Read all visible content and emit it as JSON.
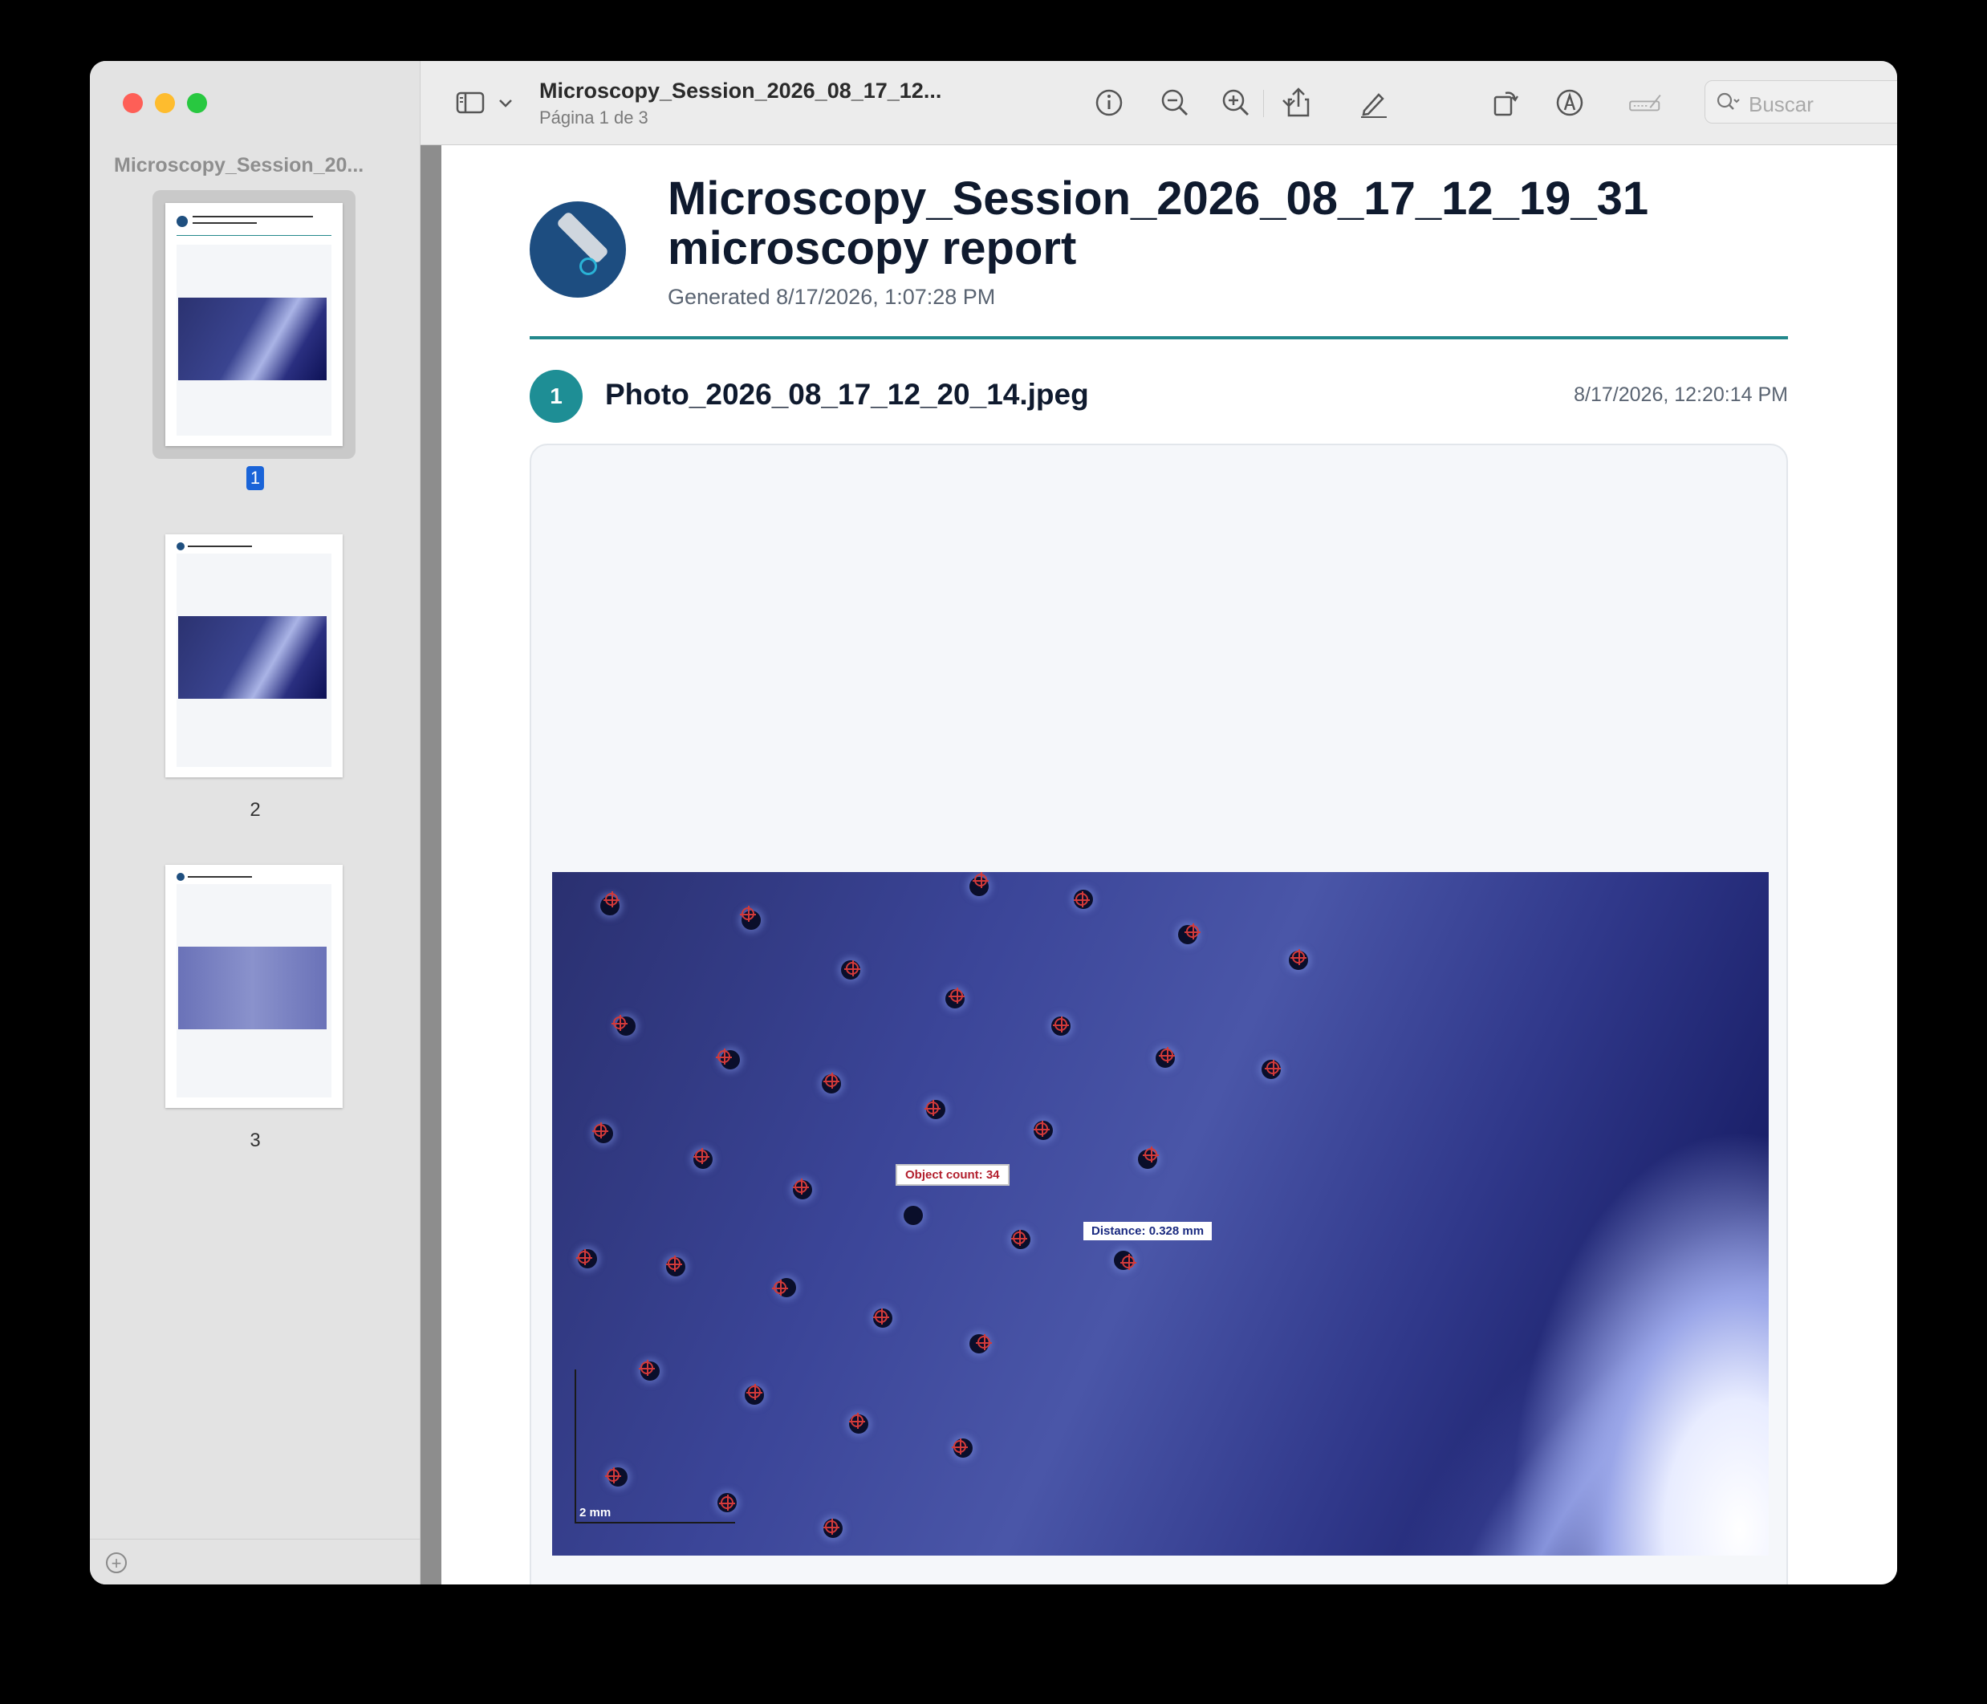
{
  "window": {
    "sidebar_title": "Microscopy_Session_20...",
    "doc_title": "Microscopy_Session_2026_08_17_12...",
    "doc_subtitle": "Página 1 de 3",
    "search_placeholder": "Buscar"
  },
  "thumbnails": [
    {
      "page": "1",
      "selected": true
    },
    {
      "page": "2",
      "selected": false
    },
    {
      "page": "3",
      "selected": false
    }
  ],
  "report": {
    "title_line1": "Microscopy_Session_2026_08_17_12_19_31",
    "title_line2": "microscopy report",
    "generated": "Generated 8/17/2026, 1:07:28 PM"
  },
  "photo": {
    "index": "1",
    "name": "Photo_2026_08_17_12_20_14.jpeg",
    "timestamp": "8/17/2026, 12:20:14 PM",
    "annotation_count": "Object count: 34",
    "annotation_distance": "Distance: 0.328 mm",
    "scale_label": "2 mm"
  },
  "icons": {
    "sidebar_toggle": "sidebar-icon",
    "info": "info-icon",
    "zoom_out": "zoom-out-icon",
    "zoom_in": "zoom-in-icon",
    "share": "share-icon",
    "markup": "pencil-icon",
    "rotate": "rotate-icon",
    "annotate": "markup-circle-icon",
    "form": "form-icon",
    "search": "search-icon"
  },
  "colors": {
    "accent": "#23888c",
    "selection": "#1a64d8",
    "title": "#0f1a2e"
  }
}
